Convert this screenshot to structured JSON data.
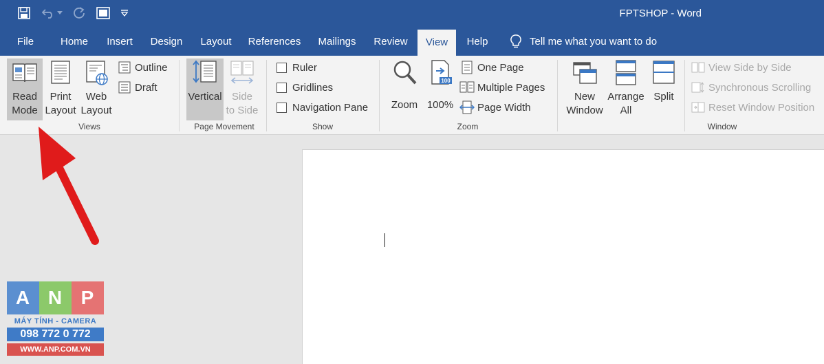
{
  "window": {
    "title": "FPTSHOP  -  Word"
  },
  "qat": {
    "icons": [
      "save-icon",
      "undo-icon",
      "redo-icon",
      "touch-mode-icon",
      "customize-qat-icon"
    ]
  },
  "tabs": [
    {
      "label": "File"
    },
    {
      "label": "Home"
    },
    {
      "label": "Insert"
    },
    {
      "label": "Design"
    },
    {
      "label": "Layout"
    },
    {
      "label": "References"
    },
    {
      "label": "Mailings"
    },
    {
      "label": "Review"
    },
    {
      "label": "View",
      "active": true
    },
    {
      "label": "Help"
    }
  ],
  "tell_me": {
    "placeholder": "Tell me what you want to do"
  },
  "ribbon": {
    "views": {
      "label": "Views",
      "read_mode": [
        "Read",
        "Mode"
      ],
      "print_layout": [
        "Print",
        "Layout"
      ],
      "web_layout": [
        "Web",
        "Layout"
      ],
      "outline": "Outline",
      "draft": "Draft"
    },
    "page_movement": {
      "label": "Page Movement",
      "vertical": "Vertical",
      "side_to_side": [
        "Side",
        "to Side"
      ]
    },
    "show": {
      "label": "Show",
      "ruler": "Ruler",
      "gridlines": "Gridlines",
      "navigation_pane": "Navigation Pane"
    },
    "zoom": {
      "label": "Zoom",
      "zoom": "Zoom",
      "hundred": "100%",
      "one_page": "One Page",
      "multiple_pages": "Multiple Pages",
      "page_width": "Page Width"
    },
    "window": {
      "label": "Window",
      "new_window": [
        "New",
        "Window"
      ],
      "arrange_all": [
        "Arrange",
        "All"
      ],
      "split": "Split",
      "view_side_by_side": "View Side by Side",
      "synchronous_scrolling": "Synchronous Scrolling",
      "reset_window_position": "Reset Window Position"
    }
  },
  "watermark": {
    "letters": [
      "A",
      "N",
      "P"
    ],
    "subtitle": "MÁY TÍNH - CAMERA",
    "phone": "098 772 0 772",
    "website": "WWW.ANP.COM.VN"
  },
  "colors": {
    "accent": "#2b579a",
    "logo_blue": "#3f7bc7",
    "logo_red": "#d9534f",
    "logo_green": "#5cb85c"
  }
}
